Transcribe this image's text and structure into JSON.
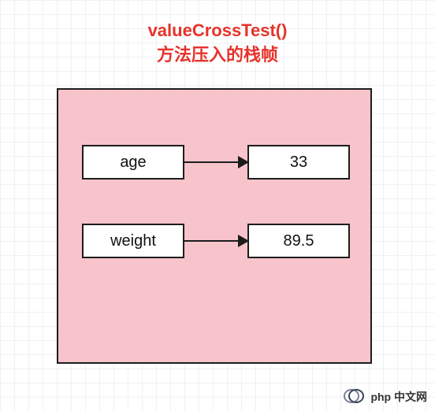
{
  "title": {
    "line1": "valueCrossTest()",
    "line2": "方法压入的栈帧"
  },
  "frame": {
    "rows": [
      {
        "key": "age",
        "value": "33"
      },
      {
        "key": "weight",
        "value": "89.5"
      }
    ]
  },
  "watermark": {
    "text": "php 中文网"
  }
}
